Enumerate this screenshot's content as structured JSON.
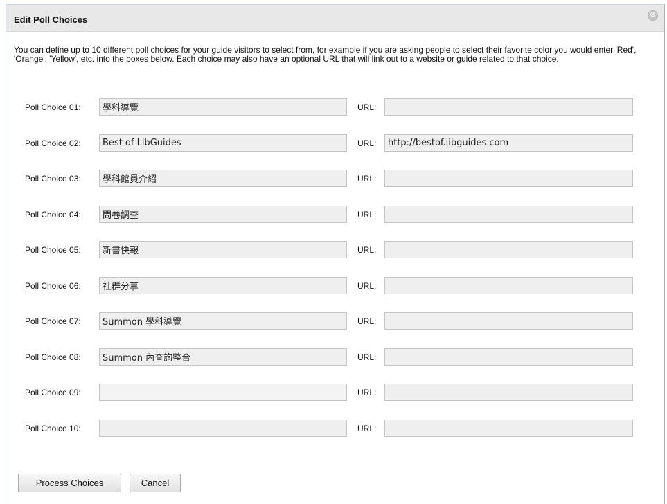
{
  "dialog": {
    "title": "Edit Poll Choices",
    "close_glyph": "⊗",
    "description": "You can define up to 10 different poll choices for your guide visitors to select from, for example if you are asking people to select their favorite color you would enter 'Red', 'Orange', 'Yellow', etc. into the boxes below. Each choice may also have an optional URL that will link out to a website or guide related to that choice."
  },
  "choices": [
    {
      "label": "Poll Choice 01:",
      "value": "學科導覽",
      "url_label": "URL:",
      "url": ""
    },
    {
      "label": "Poll Choice 02:",
      "value": "Best of LibGuides",
      "url_label": "URL:",
      "url": "http://bestof.libguides.com"
    },
    {
      "label": "Poll Choice 03:",
      "value": "學科館員介紹",
      "url_label": "URL:",
      "url": ""
    },
    {
      "label": "Poll Choice 04:",
      "value": "問卷調查",
      "url_label": "URL:",
      "url": ""
    },
    {
      "label": "Poll Choice 05:",
      "value": "新書快報",
      "url_label": "URL:",
      "url": ""
    },
    {
      "label": "Poll Choice 06:",
      "value": "社群分享",
      "url_label": "URL:",
      "url": ""
    },
    {
      "label": "Poll Choice 07:",
      "value": "Summon 學科導覽",
      "url_label": "URL:",
      "url": ""
    },
    {
      "label": "Poll Choice 08:",
      "value": "Summon 內查詢整合",
      "url_label": "URL:",
      "url": ""
    },
    {
      "label": "Poll Choice 09:",
      "value": "",
      "url_label": "URL:",
      "url": ""
    },
    {
      "label": "Poll Choice 10:",
      "value": "",
      "url_label": "URL:",
      "url": ""
    }
  ],
  "buttons": {
    "process": "Process Choices",
    "cancel": "Cancel"
  },
  "colors": {
    "cursor_accent": "#1e90ff"
  }
}
